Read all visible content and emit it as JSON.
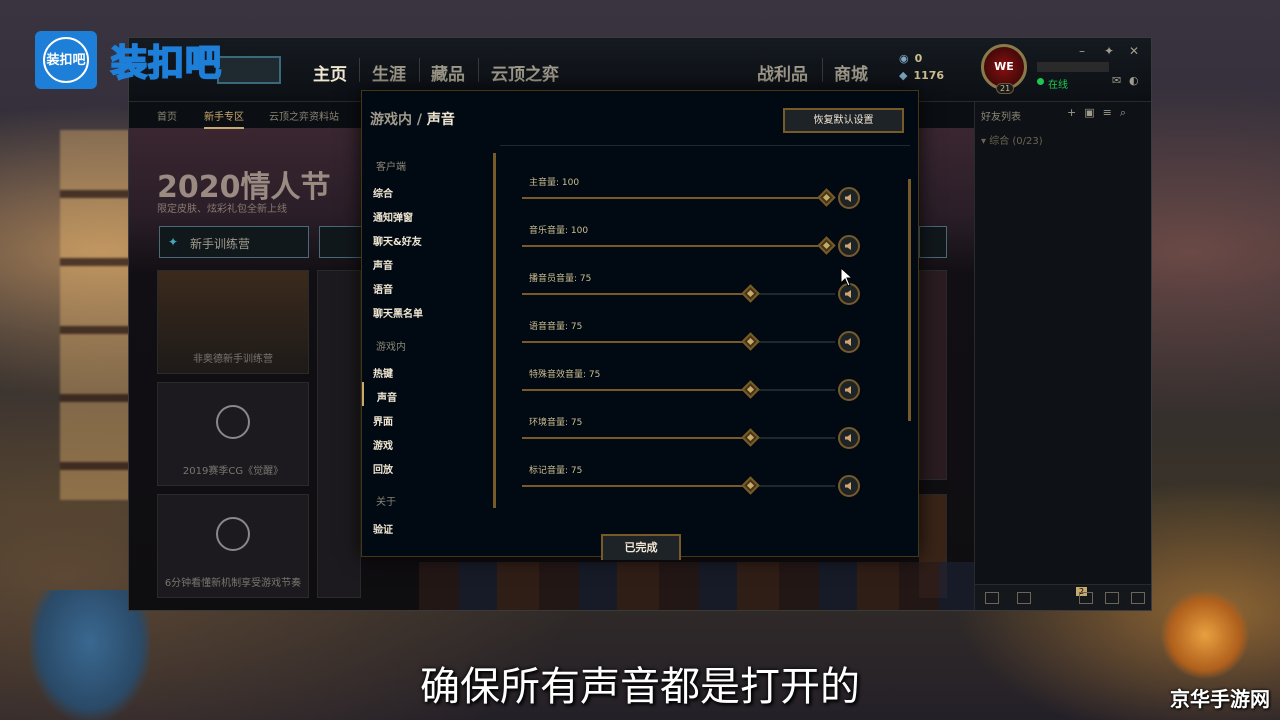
{
  "watermark": {
    "badge": "装扣吧",
    "brand": "装扣吧",
    "corner": "京华手游网"
  },
  "subtitle": "确保所有声音都是打开的",
  "client": {
    "nav": [
      "主页",
      "生涯",
      "藏品",
      "云顶之弈"
    ],
    "nav_right": [
      "战利品",
      "商城"
    ],
    "currency": {
      "rp": "0",
      "be": "1176"
    },
    "profile": {
      "badge": "WE",
      "level": "21",
      "status": "在线"
    },
    "subnav": [
      "首页",
      "新手专区",
      "云顶之弈资料站"
    ],
    "banner": {
      "title": "2020情人节",
      "subtitle": "限定皮肤、炫彩礼包全新上线"
    },
    "tile_button": "新手训练营",
    "cards": [
      "非奥德新手训练营",
      "2019赛季CG《觉醒》",
      "6分钟看懂新机制享受游戏节奏"
    ],
    "friends": {
      "header": "好友列表",
      "group": "综合 (0/23)",
      "badge": "2"
    }
  },
  "settings": {
    "title_prefix": "游戏内",
    "title_separator": "/",
    "title_current": "声音",
    "restore_label": "恢复默认设置",
    "done_label": "已完成",
    "sidebar": {
      "client_group": "客户端",
      "client_items": [
        "综合",
        "通知弹窗",
        "聊天&好友",
        "声音",
        "语音",
        "聊天黑名单"
      ],
      "ingame_group": "游戏内",
      "ingame_items": [
        "热键",
        "声音",
        "界面",
        "游戏",
        "回放"
      ],
      "about_group": "关于",
      "about_items": [
        "验证"
      ],
      "active": "声音"
    },
    "sliders": [
      {
        "label": "主音量: 100",
        "value": 100
      },
      {
        "label": "音乐音量: 100",
        "value": 100
      },
      {
        "label": "播音员音量: 75",
        "value": 75
      },
      {
        "label": "语音音量: 75",
        "value": 75
      },
      {
        "label": "特殊音效音量: 75",
        "value": 75
      },
      {
        "label": "环境音量: 75",
        "value": 75
      },
      {
        "label": "标记音量: 75",
        "value": 75
      }
    ],
    "icons": {
      "mute": "speaker-icon"
    }
  },
  "colors": {
    "gold": "#c8aa6e",
    "gold_dark": "#785a28",
    "panel": "#010a13"
  }
}
